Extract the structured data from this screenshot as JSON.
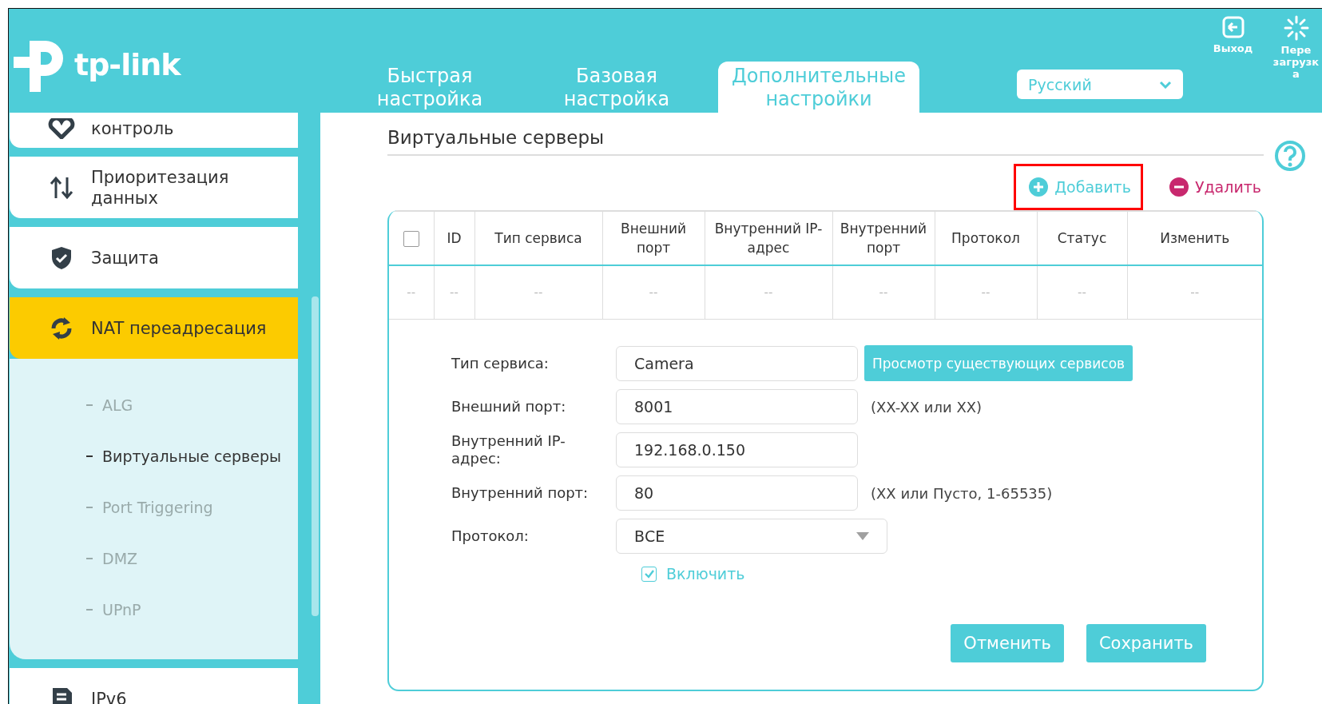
{
  "header": {
    "logo": "tp-link",
    "tabs": [
      {
        "label": "Быстрая настройка",
        "selected": false
      },
      {
        "label": "Базовая настройка",
        "selected": false
      },
      {
        "label": "Дополнительные настройки",
        "selected": true
      }
    ],
    "language": "Русский",
    "actions": [
      {
        "kind": "logout",
        "lines": [
          "Выход"
        ]
      },
      {
        "kind": "reboot",
        "lines": [
          "Пере",
          "загрузк",
          "а"
        ]
      }
    ]
  },
  "sidebar": {
    "items": [
      {
        "kind": "parental",
        "label": "контроль",
        "selected": false
      },
      {
        "kind": "priority",
        "label": "Приоритезация данных",
        "selected": false
      },
      {
        "kind": "security",
        "label": "Защита",
        "selected": false
      },
      {
        "kind": "nat",
        "label": "NAT переадресация",
        "selected": true,
        "children": [
          {
            "label": "ALG",
            "selected": false
          },
          {
            "label": "Виртуальные серверы",
            "selected": true
          },
          {
            "label": "Port Triggering",
            "selected": false
          },
          {
            "label": "DMZ",
            "selected": false
          },
          {
            "label": "UPnP",
            "selected": false
          }
        ]
      },
      {
        "kind": "ipv6",
        "label": "IPv6",
        "selected": false
      }
    ]
  },
  "page": {
    "title": "Виртуальные серверы",
    "toolbar": [
      {
        "kind": "add",
        "label": "Добавить",
        "highlighted": true
      },
      {
        "kind": "delete",
        "label": "Удалить",
        "highlighted": false
      }
    ],
    "table": {
      "select_all": {
        "checked": false
      },
      "columns": [
        "",
        "ID",
        "Тип сервиса",
        "Внешний порт",
        "Внутренний IP-адрес",
        "Внутренний порт",
        "Протокол",
        "Статус",
        "Изменить"
      ],
      "rows": [
        [
          "--",
          "--",
          "--",
          "--",
          "--",
          "--",
          "--",
          "--",
          "--"
        ]
      ]
    },
    "form": {
      "fields": [
        {
          "kind": "text",
          "label": "Тип сервиса:",
          "value": "Camera",
          "button": "Просмотр существующих сервисов"
        },
        {
          "kind": "text",
          "label": "Внешний порт:",
          "value": "8001",
          "hint": "(XX-XX или XX)"
        },
        {
          "kind": "text",
          "label": "Внутренний IP-адрес:",
          "value": "192.168.0.150"
        },
        {
          "kind": "text",
          "label": "Внутренний порт:",
          "value": "80",
          "hint": "(XX или Пусто, 1-65535)"
        },
        {
          "kind": "select",
          "label": "Протокол:",
          "value": "ВСЕ"
        }
      ],
      "enable": {
        "label": "Включить",
        "checked": true
      },
      "buttons": [
        "Отменить",
        "Сохранить"
      ]
    }
  }
}
